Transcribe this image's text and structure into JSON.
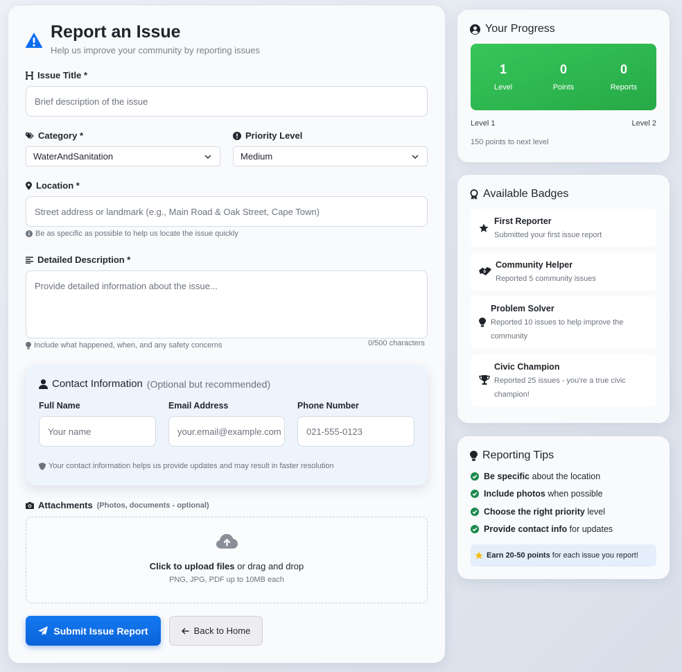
{
  "form": {
    "title": "Report an Issue",
    "subtitle": "Help us improve your community by reporting issues",
    "issue_title": {
      "label": "Issue Title *",
      "placeholder": "Brief description of the issue"
    },
    "category": {
      "label": "Category *",
      "value": "WaterAndSanitation"
    },
    "priority": {
      "label": "Priority Level",
      "value": "Medium"
    },
    "location": {
      "label": "Location *",
      "placeholder": "Street address or landmark (e.g., Main Road & Oak Street, Cape Town)",
      "hint": "Be as specific as possible to help us locate the issue quickly"
    },
    "description": {
      "label": "Detailed Description *",
      "placeholder": "Provide detailed information about the issue...",
      "hint": "Include what happened, when, and any safety concerns",
      "counter": "0/500 characters"
    },
    "contact": {
      "title": "Contact Information",
      "optional": "(Optional but recommended)",
      "full_name": {
        "label": "Full Name",
        "placeholder": "Your name"
      },
      "email": {
        "label": "Email Address",
        "placeholder": "your.email@example.com"
      },
      "phone": {
        "label": "Phone Number",
        "placeholder": "021-555-0123"
      },
      "note": "Your contact information helps us provide updates and may result in faster resolution"
    },
    "attachments": {
      "label": "Attachments",
      "optional": "(Photos, documents - optional)",
      "upload_bold": "Click to upload files",
      "upload_rest": "or drag and drop",
      "formats": "PNG, JPG, PDF up to 10MB each"
    },
    "submit_label": "Submit Issue Report",
    "back_label": "Back to Home"
  },
  "progress": {
    "title": "Your Progress",
    "stats": [
      {
        "value": "1",
        "label": "Level"
      },
      {
        "value": "0",
        "label": "Points"
      },
      {
        "value": "0",
        "label": "Reports"
      }
    ],
    "level_from": "Level 1",
    "level_to": "Level 2",
    "next_level": "150 points to next level"
  },
  "badges": {
    "title": "Available Badges",
    "items": [
      {
        "name": "First Reporter",
        "desc": "Submitted your first issue report",
        "icon": "star-icon"
      },
      {
        "name": "Community Helper",
        "desc": "Reported 5 community issues",
        "icon": "handshake-icon"
      },
      {
        "name": "Problem Solver",
        "desc": "Reported 10 issues to help improve the community",
        "icon": "lightbulb-icon"
      },
      {
        "name": "Civic Champion",
        "desc": "Reported 25 issues - you're a true civic champion!",
        "icon": "trophy-icon"
      }
    ]
  },
  "tips": {
    "title": "Reporting Tips",
    "items": [
      {
        "bold": "Be specific",
        "rest": "about the location"
      },
      {
        "bold": "Include photos",
        "rest": "when possible"
      },
      {
        "bold": "Choose the right priority",
        "rest": "level"
      },
      {
        "bold": "Provide contact info",
        "rest": "for updates"
      }
    ],
    "earn_bold": "Earn 20-50 points",
    "earn_rest": "for each issue you report!"
  },
  "colors": {
    "primary": "#0a63d8",
    "success": "#26a946",
    "warning": "#f5b90f",
    "check": "#1b8a4c"
  }
}
